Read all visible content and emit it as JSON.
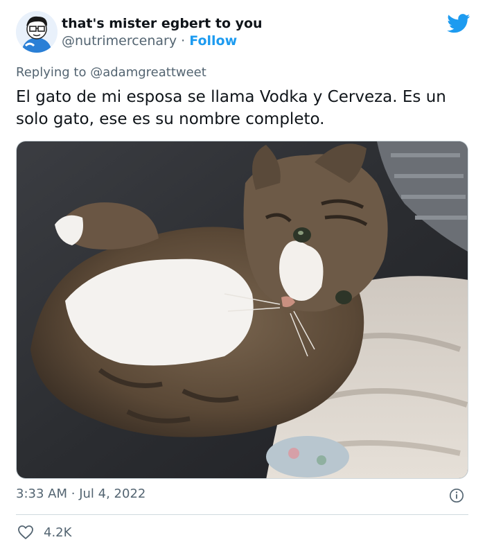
{
  "author": {
    "display_name": "that's mister egbert to you",
    "handle": "@nutrimercenary",
    "separator": "·",
    "follow_label": "Follow",
    "avatar_icon": "cartoon-character-avatar"
  },
  "platform_icon": "twitter-bird-icon",
  "reply": {
    "prefix": "Replying to",
    "target": "@adamgreattweet"
  },
  "tweet": {
    "text": "El gato de mi esposa se llama Vodka y Cerveza. Es un solo gato, ese es su nombre completo."
  },
  "media": {
    "subject": "photo-tabby-cat-lying-on-blanket"
  },
  "meta": {
    "time": "3:33 AM",
    "separator": "·",
    "date": "Jul 4, 2022",
    "info_icon": "info-icon"
  },
  "engagement": {
    "like_icon": "heart-icon",
    "like_count": "4.2K"
  },
  "colors": {
    "accent": "#1d9bf0",
    "secondary_text": "#536471",
    "primary_text": "#0f1419"
  }
}
